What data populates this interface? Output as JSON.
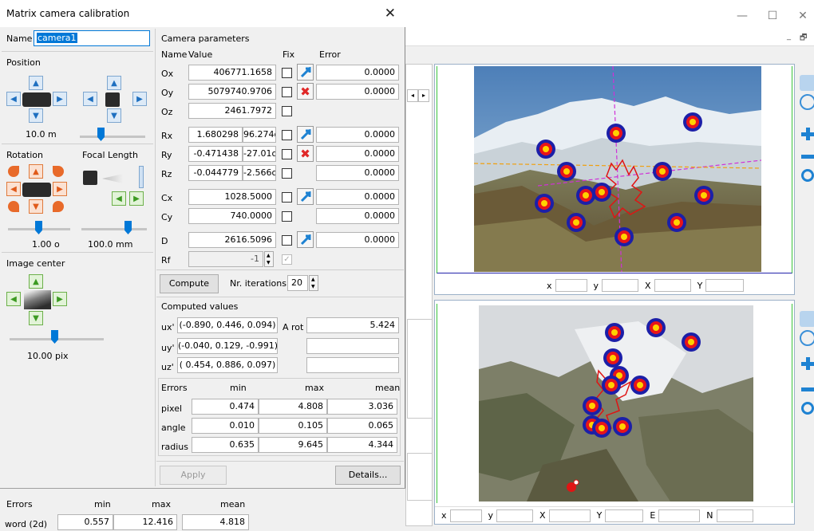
{
  "dialog": {
    "title": "Matrix camera calibration",
    "name_label": "Name",
    "name_value": "camera1",
    "position_label": "Position",
    "distance_value": "10.0  m",
    "rotation_label": "Rotation",
    "focal_length_label": "Focal Length",
    "rotation_value": "1.00 o",
    "focal_value": "100.0  mm",
    "image_center_label": "Image center",
    "image_center_value": "10.00  pix",
    "camera_parameters_label": "Camera parameters",
    "col_name": "Name",
    "col_value": "Value",
    "col_fix": "Fix",
    "col_error": "Error",
    "params": [
      {
        "name": "Ox",
        "value": "406771.1658",
        "error": "0.0000",
        "fix_icon": "blue"
      },
      {
        "name": "Oy",
        "value": "5079740.9706",
        "error": "0.0000",
        "fix_icon": "red"
      },
      {
        "name": "Oz",
        "value": "2461.7972",
        "error": "",
        "fix_icon": "none"
      },
      {
        "name": "Rx",
        "value": "1.680298",
        "deg": "96.274o",
        "error": "0.0000",
        "fix_icon": "blue"
      },
      {
        "name": "Ry",
        "value": "-0.471438",
        "deg": "-27.01o",
        "error": "0.0000",
        "fix_icon": "red"
      },
      {
        "name": "Rz",
        "value": "-0.044779",
        "deg": "-2.566o",
        "error": "0.0000",
        "fix_icon": "none"
      },
      {
        "name": "Cx",
        "value": "1028.5000",
        "error": "0.0000",
        "fix_icon": "blue"
      },
      {
        "name": "Cy",
        "value": "740.0000",
        "error": "0.0000",
        "fix_icon": "none"
      },
      {
        "name": "D",
        "value": "2616.5096",
        "error": "0.0000",
        "fix_icon": "blue"
      },
      {
        "name": "Rf",
        "value": "-1",
        "error": "",
        "fix_icon": "none"
      }
    ],
    "compute_label": "Compute",
    "iterations_label": "Nr. iterations",
    "iterations_value": "20",
    "computed_values_label": "Computed values",
    "ux_label": "ux'",
    "ux_value": "(-0.890, 0.446, 0.094)",
    "arot_label": "A rot",
    "arot_value": "5.424",
    "uy_label": "uy'",
    "uy_value": "(-0.040, 0.129, -0.991)",
    "uz_label": "uz'",
    "uz_value": "( 0.454, 0.886, 0.097)",
    "errors": {
      "header": [
        "Errors",
        "min",
        "max",
        "mean"
      ],
      "rows": [
        {
          "label": "pixel",
          "min": "0.474",
          "max": "4.808",
          "mean": "3.036"
        },
        {
          "label": "angle",
          "min": "0.010",
          "max": "0.105",
          "mean": "0.065"
        },
        {
          "label": "radius",
          "min": "0.635",
          "max": "9.645",
          "mean": "4.344"
        }
      ]
    },
    "apply_label": "Apply",
    "details_label": "Details...",
    "bottom_errors": {
      "header": [
        "Errors",
        "min",
        "max",
        "mean"
      ],
      "row": {
        "label": "word (2d)",
        "min": "0.557",
        "max": "12.416",
        "mean": "4.818"
      }
    }
  },
  "viewer": {
    "top_coords": [
      "x",
      "y",
      "X",
      "Y"
    ],
    "bottom_coords": [
      "x",
      "y",
      "X",
      "Y",
      "E",
      "N"
    ]
  },
  "colors": {
    "accent": "#0078d7",
    "target_outer": "#1c1fa8",
    "target_mid": "#e8141a",
    "target_center": "#ffd200",
    "track_red": "#e01414",
    "guide_magenta": "#d030d8",
    "guide_orange": "#f0a010"
  }
}
